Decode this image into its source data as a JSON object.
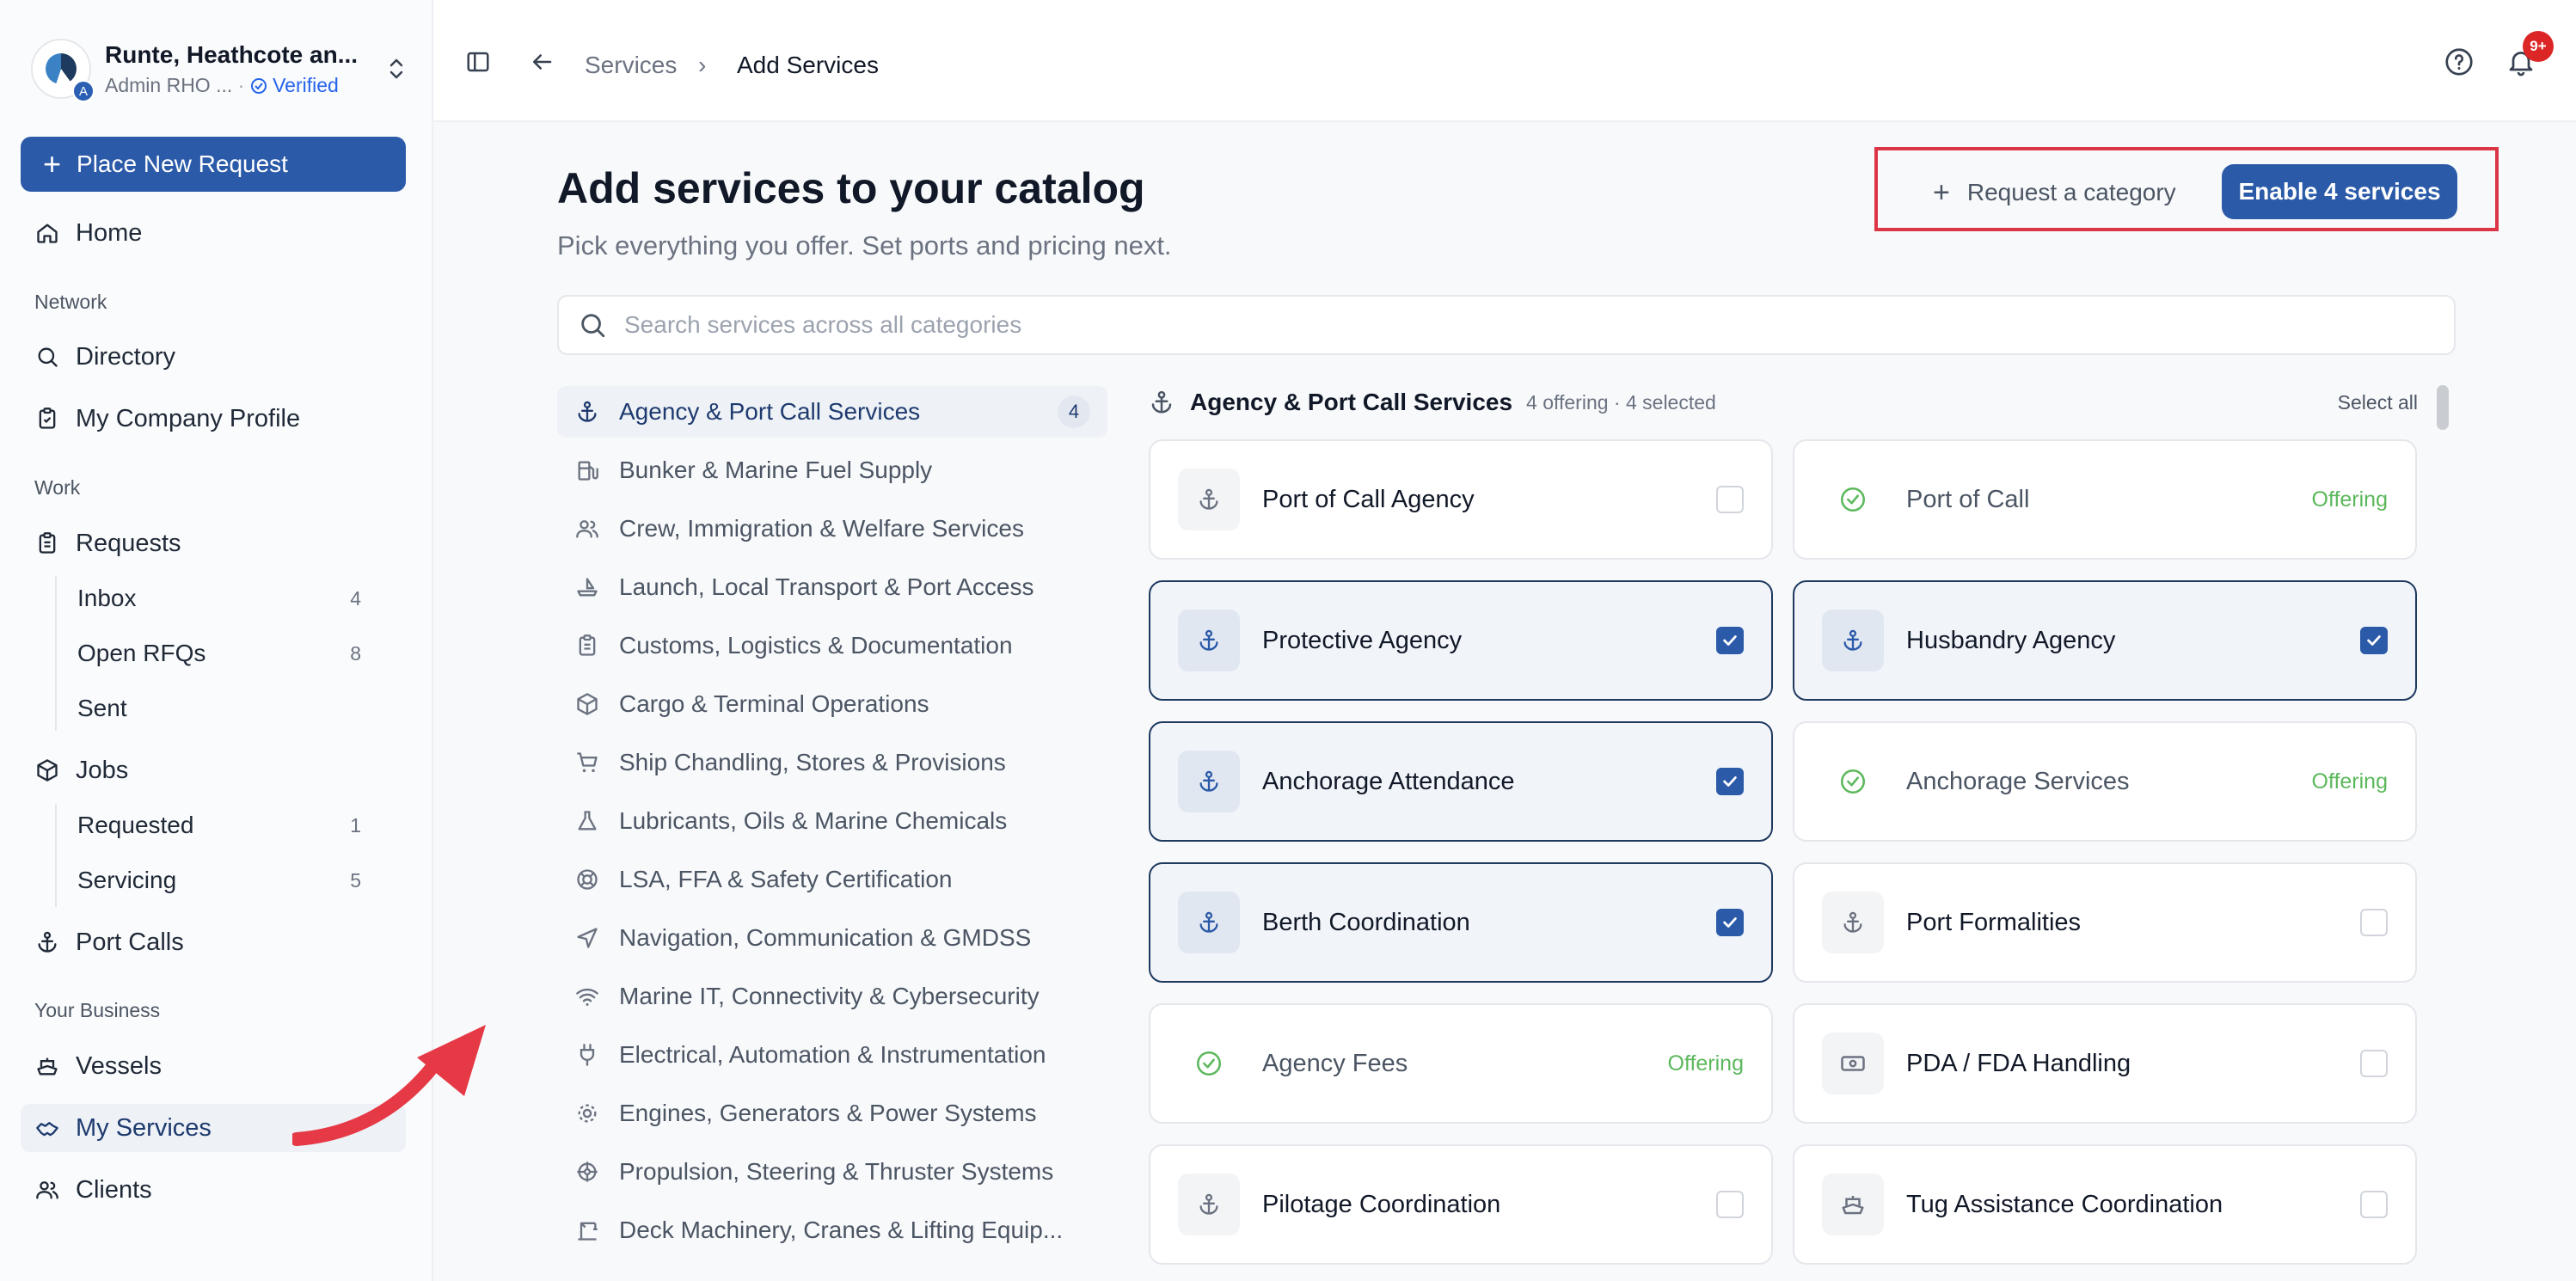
{
  "org": {
    "name": "Runte, Heathcote an...",
    "role": "Admin RHO ...",
    "separator": "·",
    "verified": "Verified",
    "badge": "A"
  },
  "sidebar": {
    "place_request": "Place New Request",
    "home": "Home",
    "network_label": "Network",
    "directory": "Directory",
    "company_profile": "My Company Profile",
    "work_label": "Work",
    "requests": "Requests",
    "requests_sub": [
      {
        "label": "Inbox",
        "count": "4"
      },
      {
        "label": "Open RFQs",
        "count": "8"
      },
      {
        "label": "Sent",
        "count": ""
      }
    ],
    "jobs": "Jobs",
    "jobs_sub": [
      {
        "label": "Requested",
        "count": "1"
      },
      {
        "label": "Servicing",
        "count": "5"
      }
    ],
    "port_calls": "Port Calls",
    "business_label": "Your Business",
    "vessels": "Vessels",
    "my_services": "My Services",
    "clients": "Clients"
  },
  "topbar": {
    "breadcrumb_parent": "Services",
    "breadcrumb_current": "Add Services",
    "notif_count": "9+"
  },
  "page": {
    "title": "Add services to your catalog",
    "subtitle": "Pick everything you offer. Set ports and pricing next.",
    "request_category": "Request a category",
    "enable_button": "Enable 4 services",
    "search_placeholder": "Search services across all categories"
  },
  "categories": [
    {
      "label": "Agency & Port Call Services",
      "icon": "anchor-icon",
      "badge": "4"
    },
    {
      "label": "Bunker & Marine Fuel Supply",
      "icon": "fuel-icon"
    },
    {
      "label": "Crew, Immigration & Welfare Services",
      "icon": "users-icon"
    },
    {
      "label": "Launch, Local Transport & Port Access",
      "icon": "boat-icon"
    },
    {
      "label": "Customs, Logistics & Documentation",
      "icon": "clipboard-icon"
    },
    {
      "label": "Cargo & Terminal Operations",
      "icon": "box-icon"
    },
    {
      "label": "Ship Chandling, Stores & Provisions",
      "icon": "cart-icon"
    },
    {
      "label": "Lubricants, Oils & Marine Chemicals",
      "icon": "flask-icon"
    },
    {
      "label": "LSA, FFA & Safety Certification",
      "icon": "lifebuoy-icon"
    },
    {
      "label": "Navigation, Communication & GMDSS",
      "icon": "navigation-icon"
    },
    {
      "label": "Marine IT, Connectivity & Cybersecurity",
      "icon": "wifi-icon"
    },
    {
      "label": "Electrical, Automation & Instrumentation",
      "icon": "plug-icon"
    },
    {
      "label": "Engines, Generators & Power Systems",
      "icon": "cog-icon"
    },
    {
      "label": "Propulsion, Steering & Thruster Systems",
      "icon": "propeller-icon"
    },
    {
      "label": "Deck Machinery, Cranes & Lifting Equip...",
      "icon": "crane-icon"
    }
  ],
  "panel": {
    "title": "Agency & Port Call Services",
    "meta": "4 offering · 4 selected",
    "select_all": "Select all"
  },
  "services": [
    {
      "name": "Port of Call Agency",
      "state": "unchecked",
      "icon": "anchor-icon"
    },
    {
      "name": "Port of Call",
      "state": "offering",
      "label": "Offering",
      "icon": "check-circle-icon"
    },
    {
      "name": "Protective Agency",
      "state": "selected",
      "icon": "anchor-icon"
    },
    {
      "name": "Husbandry Agency",
      "state": "selected",
      "icon": "anchor-icon"
    },
    {
      "name": "Anchorage Attendance",
      "state": "selected",
      "icon": "anchor-icon"
    },
    {
      "name": "Anchorage Services",
      "state": "offering",
      "label": "Offering",
      "icon": "check-circle-icon"
    },
    {
      "name": "Berth Coordination",
      "state": "selected",
      "icon": "anchor-icon"
    },
    {
      "name": "Port Formalities",
      "state": "unchecked",
      "icon": "anchor-icon"
    },
    {
      "name": "Agency Fees",
      "state": "offering",
      "label": "Offering",
      "icon": "check-circle-icon"
    },
    {
      "name": "PDA / FDA Handling",
      "state": "unchecked",
      "icon": "cash-icon"
    },
    {
      "name": "Pilotage Coordination",
      "state": "unchecked",
      "icon": "anchor-icon"
    },
    {
      "name": "Tug Assistance Coordination",
      "state": "unchecked",
      "icon": "ship-icon"
    }
  ],
  "colors": {
    "primary": "#2b5aa8",
    "highlight_box": "#dc3545",
    "offering": "#5cb85c",
    "annotation_arrow": "#e63946"
  }
}
